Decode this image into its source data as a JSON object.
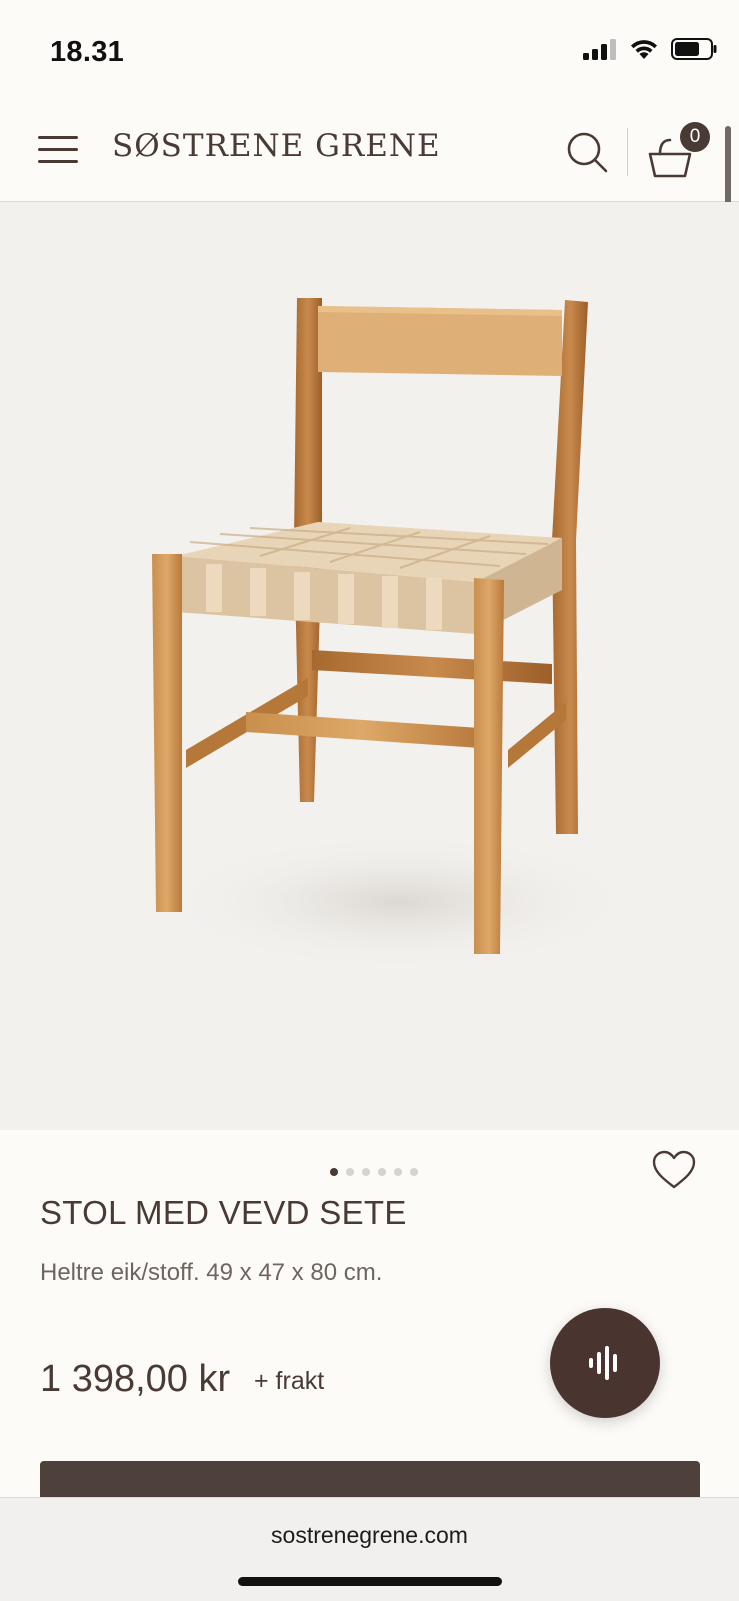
{
  "status_bar": {
    "time": "18.31"
  },
  "header": {
    "logo_text": "SØSTRENE GRENE",
    "cart_count": "0"
  },
  "product": {
    "image_alt": "Chair with woven seat",
    "carousel_total": 6,
    "carousel_active": 1,
    "title": "STOL MED VEVD SETE",
    "description": "Heltre eik/stoff. 49 x 47 x 80 cm.",
    "price": "1 398,00 kr",
    "shipping": "+ frakt"
  },
  "browser": {
    "url": "sostrenegrene.com"
  },
  "colors": {
    "brand_brown": "#4a3a34",
    "background": "#fcfbf8",
    "image_bg": "#f3f1ee"
  }
}
